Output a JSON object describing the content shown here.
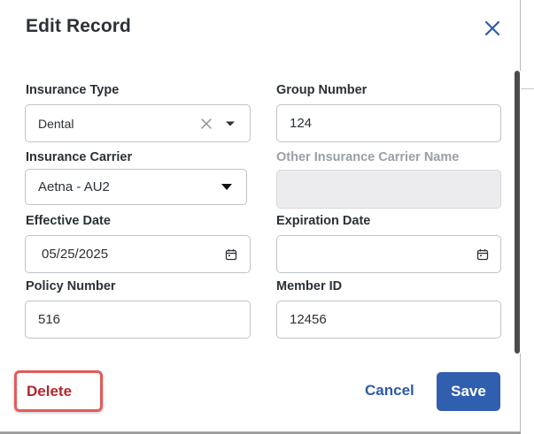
{
  "dialog": {
    "title": "Edit Record"
  },
  "fields": {
    "insurance_type": {
      "label": "Insurance Type",
      "value": "Dental"
    },
    "group_number": {
      "label": "Group Number",
      "value": "124"
    },
    "insurance_carrier": {
      "label": "Insurance Carrier",
      "value": "Aetna - AU2"
    },
    "other_carrier": {
      "label": "Other Insurance Carrier Name",
      "value": ""
    },
    "effective_date": {
      "label": "Effective Date",
      "value": "05/25/2025"
    },
    "expiration_date": {
      "label": "Expiration Date",
      "value": ""
    },
    "policy_number": {
      "label": "Policy Number",
      "value": "516"
    },
    "member_id": {
      "label": "Member ID",
      "value": "12456"
    }
  },
  "actions": {
    "delete_label": "Delete",
    "cancel_label": "Cancel",
    "save_label": "Save"
  },
  "icons": {
    "close": "close-icon",
    "clear": "clear-icon",
    "dropdown": "caret-down-icon",
    "calendar": "calendar-icon"
  },
  "colors": {
    "primary": "#2f5fae",
    "link": "#2d5ba8",
    "danger_text": "#b3262e",
    "highlight_border": "#e35b5b"
  }
}
